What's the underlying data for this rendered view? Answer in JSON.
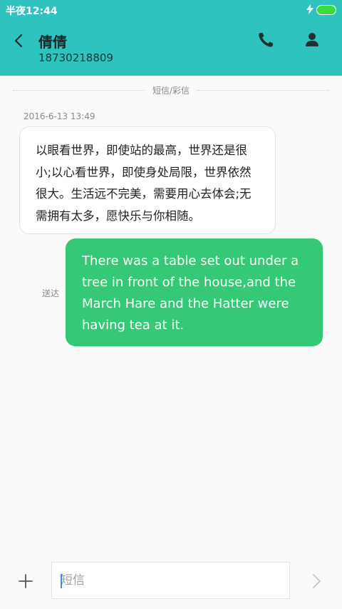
{
  "status_bar": {
    "time": "半夜12:44",
    "battery_color": "#3ddc3d"
  },
  "header": {
    "contact_name": "倩倩",
    "contact_number": "18730218809",
    "background_color": "#2ec3bf"
  },
  "conversation": {
    "divider_label": "短信/彩信",
    "messages": [
      {
        "direction": "received",
        "timestamp": "2016-6-13 13:49",
        "text": "以眼看世界，即使站的最高，世界还是很小;以心看世界，即使身处局限，世界依然很大。生活远不完美，需要用心去体会;无需拥有太多，愿快乐与你相随。"
      },
      {
        "direction": "sent",
        "status": "送达",
        "text": "There was a table set out under a tree in front of the house,and the March Hare and the Hatter were having tea at it.",
        "bubble_color": "#34c877"
      }
    ]
  },
  "composer": {
    "placeholder": "短信",
    "value": ""
  },
  "icons": {
    "back": "back-arrow-icon",
    "call": "phone-icon",
    "contact": "person-icon",
    "add": "plus-icon",
    "send": "chevron-right-icon",
    "charge": "lightning-icon",
    "battery": "battery-icon"
  }
}
